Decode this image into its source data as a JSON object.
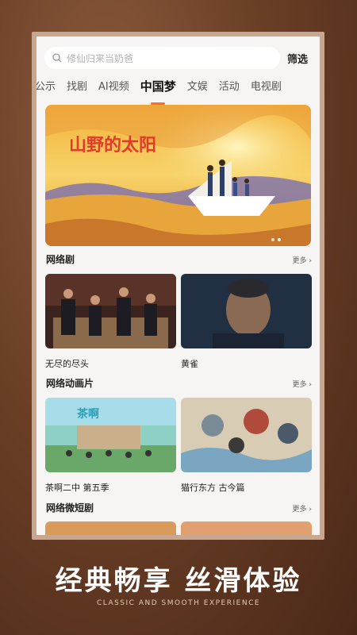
{
  "search": {
    "placeholder": "修仙归来当奶爸",
    "filter_label": "筛选"
  },
  "tabs": [
    {
      "label": "公示"
    },
    {
      "label": "找剧"
    },
    {
      "label": "AI视频"
    },
    {
      "label": "中国梦"
    },
    {
      "label": "文娱"
    },
    {
      "label": "活动"
    },
    {
      "label": "电视剧"
    }
  ],
  "banner": {
    "title_text": "山野的太阳"
  },
  "sections": [
    {
      "title": "网络剧",
      "more": "更多 ›",
      "items": [
        {
          "title": "无尽的尽头"
        },
        {
          "title": "黄雀"
        }
      ]
    },
    {
      "title": "网络动画片",
      "more": "更多 ›",
      "items": [
        {
          "title": "茶啊二中 第五季"
        },
        {
          "title": "猫行东方 古今篇"
        }
      ]
    },
    {
      "title": "网络微短剧",
      "more": "更多 ›"
    }
  ],
  "slogan": {
    "main": "经典畅享 丝滑体验",
    "sub": "CLASSIC AND SMOOTH EXPERIENCE"
  },
  "colors": {
    "accent": "#ff6b2b",
    "background": "#6b3f26"
  }
}
